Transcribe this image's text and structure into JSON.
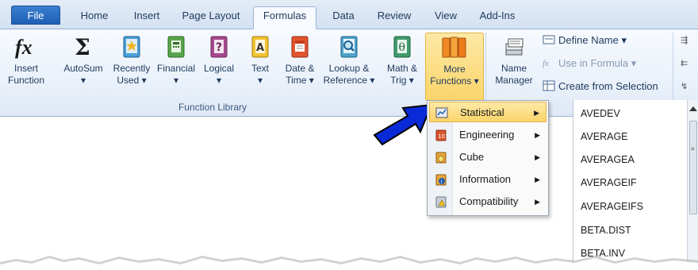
{
  "tabs": [
    {
      "label": "File"
    },
    {
      "label": "Home"
    },
    {
      "label": "Insert"
    },
    {
      "label": "Page Layout"
    },
    {
      "label": "Formulas"
    },
    {
      "label": "Data"
    },
    {
      "label": "Review"
    },
    {
      "label": "View"
    },
    {
      "label": "Add-Ins"
    }
  ],
  "ribbon": {
    "buttons": [
      {
        "line1": "Insert",
        "line2": "Function",
        "icon": "fx-icon"
      },
      {
        "line1": "AutoSum",
        "line2": "▾",
        "icon": "sigma-icon"
      },
      {
        "line1": "Recently",
        "line2": "Used ▾",
        "icon": "book-star-icon"
      },
      {
        "line1": "Financial",
        "line2": "▾",
        "icon": "book-calculator-icon"
      },
      {
        "line1": "Logical",
        "line2": "▾",
        "icon": "book-question-icon"
      },
      {
        "line1": "Text",
        "line2": "▾",
        "icon": "book-a-icon"
      },
      {
        "line1": "Date &",
        "line2": "Time ▾",
        "icon": "book-calendar-icon"
      },
      {
        "line1": "Lookup &",
        "line2": "Reference ▾",
        "icon": "book-magnifier-icon"
      },
      {
        "line1": "Math &",
        "line2": "Trig ▾",
        "icon": "book-theta-icon"
      },
      {
        "line1": "More",
        "line2": "Functions ▾",
        "icon": "books-icon"
      },
      {
        "line1": "Name",
        "line2": "Manager",
        "icon": "name-manager-icon"
      }
    ],
    "group_label": "Function Library",
    "defined_names": {
      "define_name": "Define Name ▾",
      "use_in_formula": "Use in Formula ▾",
      "create_from_selection": "Create from Selection"
    }
  },
  "more_functions_menu": [
    {
      "label": "Statistical",
      "icon": "statistical-icon"
    },
    {
      "label": "Engineering",
      "icon": "engineering-icon"
    },
    {
      "label": "Cube",
      "icon": "cube-icon"
    },
    {
      "label": "Information",
      "icon": "information-icon"
    },
    {
      "label": "Compatibility",
      "icon": "compatibility-icon"
    }
  ],
  "statistical_functions": [
    "AVEDEV",
    "AVERAGE",
    "AVERAGEA",
    "AVERAGEIF",
    "AVERAGEIFS",
    "BETA.DIST",
    "BETA.INV"
  ],
  "colors": {
    "accent": "#1f5fb4",
    "hover": "#fbd46a",
    "arrow": "#0a2ad8"
  }
}
